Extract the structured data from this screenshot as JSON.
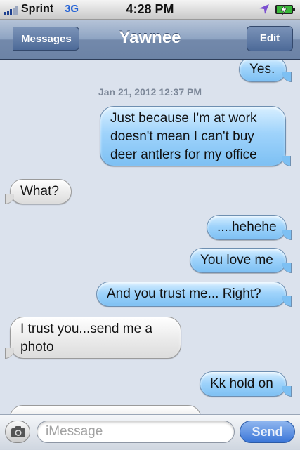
{
  "status_bar": {
    "carrier": "Sprint",
    "network": "3G",
    "time": "4:28 PM"
  },
  "nav": {
    "back_label": "Messages",
    "title": "Yawnee",
    "edit_label": "Edit"
  },
  "conversation": {
    "timestamp": "Jan 21, 2012 12:37 PM",
    "messages": [
      {
        "from": "me",
        "text": "Yes."
      },
      {
        "from": "me",
        "text": "Just because I'm at work"
      },
      {
        "from": "me",
        "text": "doesn't mean I can't buy"
      },
      {
        "from": "me",
        "text": "deer antlers for my office"
      },
      {
        "from": "them",
        "text": "What?"
      },
      {
        "from": "me",
        "text": "....hehehe"
      },
      {
        "from": "me",
        "text": "You love me"
      },
      {
        "from": "me",
        "text": "And you trust me... Right?"
      },
      {
        "from": "them",
        "text": "I trust you...send me a"
      },
      {
        "from": "them",
        "text": "photo"
      },
      {
        "from": "me",
        "text": "Kk hold on"
      }
    ]
  },
  "input_bar": {
    "placeholder": "iMessage",
    "send_label": "Send"
  },
  "colors": {
    "outgoing_bubble": "#7dc0f3",
    "incoming_bubble": "#e6e6e6",
    "background": "#dbe2ed",
    "send_button": "#3b76d8"
  }
}
